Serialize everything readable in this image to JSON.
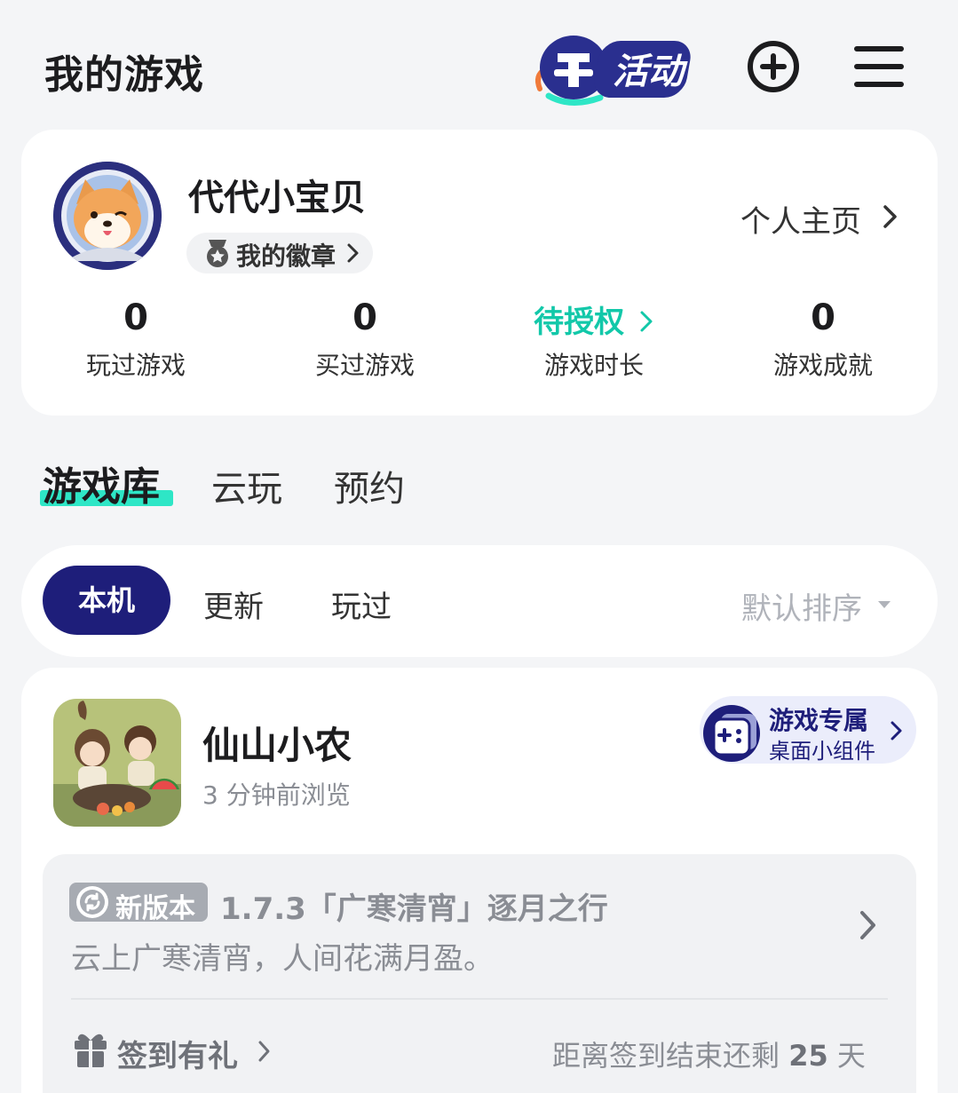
{
  "header": {
    "title": "我的游戏",
    "activity_label": "活动"
  },
  "profile": {
    "username": "代代小宝贝",
    "badge_label": "我的徽章",
    "homepage_label": "个人主页",
    "stats": [
      {
        "value": "0",
        "label": "玩过游戏"
      },
      {
        "value": "0",
        "label": "买过游戏"
      },
      {
        "value": "待授权",
        "label": "游戏时长"
      },
      {
        "value": "0",
        "label": "游戏成就"
      }
    ]
  },
  "tabs": [
    {
      "label": "游戏库",
      "active": true
    },
    {
      "label": "云玩"
    },
    {
      "label": "预约"
    }
  ],
  "filters": {
    "items": [
      "本机",
      "更新",
      "玩过"
    ],
    "sort_label": "默认排序"
  },
  "game": {
    "name": "仙山小农",
    "last_viewed": "3 分钟前浏览",
    "widget_title": "游戏专属",
    "widget_subtitle": "桌面小组件",
    "update_badge": "新版本",
    "update_title": "1.7.3「广寒清宵」逐月之行",
    "update_desc": "云上广寒清宵，人间花满月盈。",
    "signin_label": "签到有礼",
    "countdown_prefix": "距离签到结束还剩",
    "countdown_days": "25",
    "countdown_suffix": "天"
  },
  "colors": {
    "accent_teal": "#12c8a9",
    "navy": "#1e1e7a",
    "background": "#f4f5f7"
  }
}
